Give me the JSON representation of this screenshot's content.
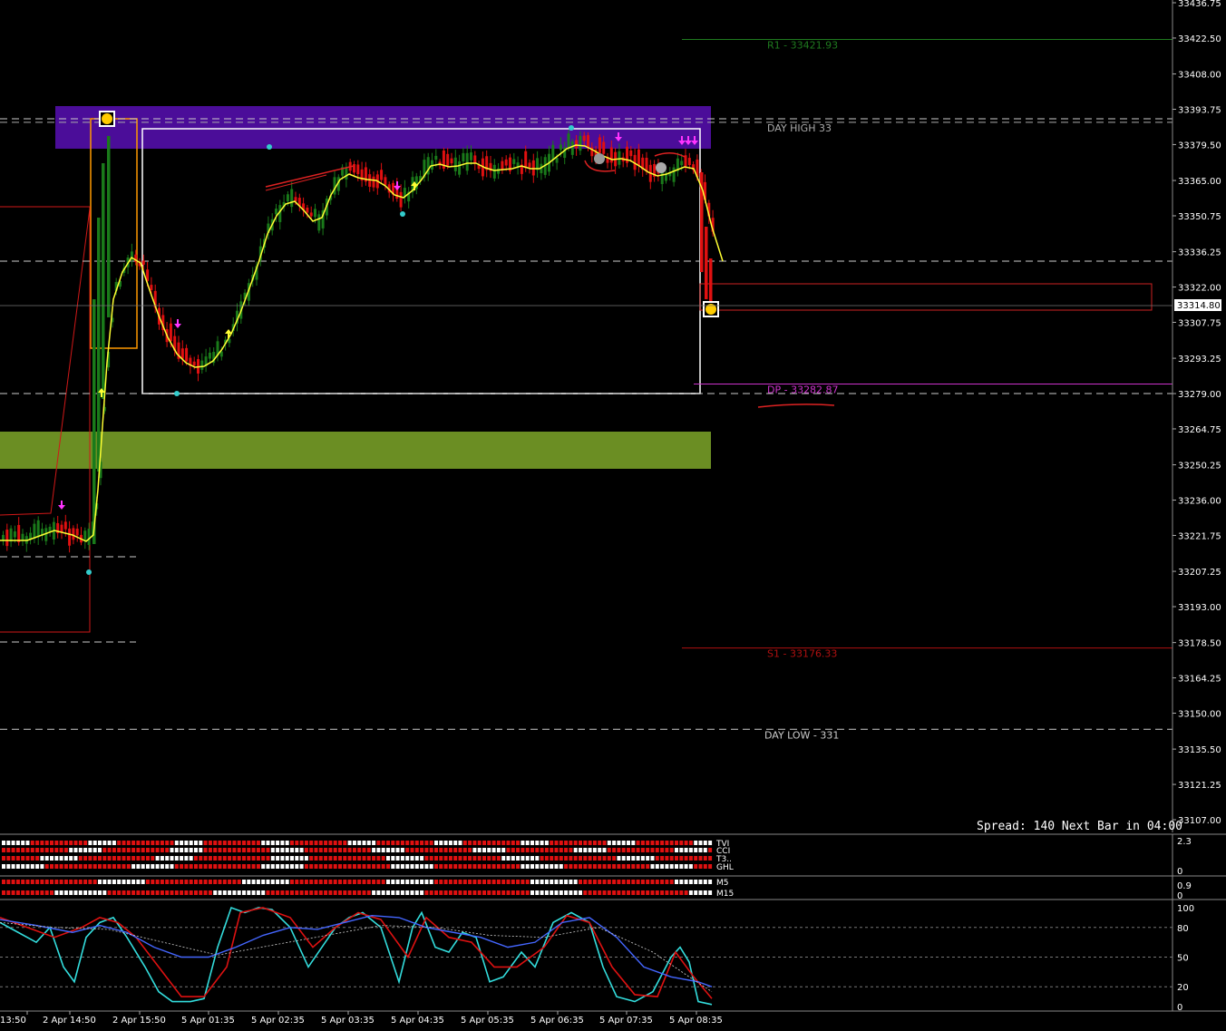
{
  "chart_data": {
    "type": "candlestick",
    "price_axis": {
      "ticks": [
        "33436.75",
        "33422.50",
        "33408.00",
        "33393.75",
        "33379.50",
        "33365.00",
        "33350.75",
        "33336.25",
        "33322.00",
        "33307.75",
        "33293.25",
        "33279.00",
        "33264.75",
        "33250.25",
        "33236.00",
        "33221.75",
        "33207.25",
        "33193.00",
        "33178.50",
        "33164.25",
        "33150.00",
        "33135.50",
        "33121.25",
        "33107.00"
      ],
      "range": [
        33107.0,
        33436.75
      ],
      "current_price": "33314.80"
    },
    "time_axis": {
      "ticks": [
        "13:50",
        "2 Apr 14:50",
        "2 Apr 15:50",
        "5 Apr 01:35",
        "5 Apr 02:35",
        "5 Apr 03:35",
        "5 Apr 04:35",
        "5 Apr 05:35",
        "5 Apr 06:35",
        "5 Apr 07:35",
        "5 Apr 08:35"
      ]
    },
    "levels": [
      {
        "label": "R1 - 33421.93",
        "price": 33421.93,
        "color": "#1f7a1f"
      },
      {
        "label": "DP - 33282.87",
        "price": 33282.87,
        "color": "#cc33cc"
      },
      {
        "label": "S1 - 33176.33",
        "price": 33176.33,
        "color": "#b01010"
      },
      {
        "label": "DAY LOW - 331",
        "price": 33143.5,
        "color": "#cccccc"
      },
      {
        "label": "DAY HIGH 33",
        "price": 33388.5,
        "color": "#aaaaaa"
      }
    ],
    "status_text": "Spread: 140 Next Bar in 04:00",
    "sub_panel_1": {
      "labels": [
        "TVI",
        "CCI",
        "T3..",
        "GHL"
      ],
      "scale": [
        "2.3",
        "0"
      ]
    },
    "sub_panel_2": {
      "labels": [
        "M5",
        "M15"
      ],
      "scale": [
        "0.9",
        "0"
      ]
    },
    "sub_panel_3": {
      "scale": [
        "100",
        "80",
        "50",
        "20",
        "0"
      ],
      "levels": [
        100,
        80,
        50,
        20,
        0
      ]
    }
  }
}
